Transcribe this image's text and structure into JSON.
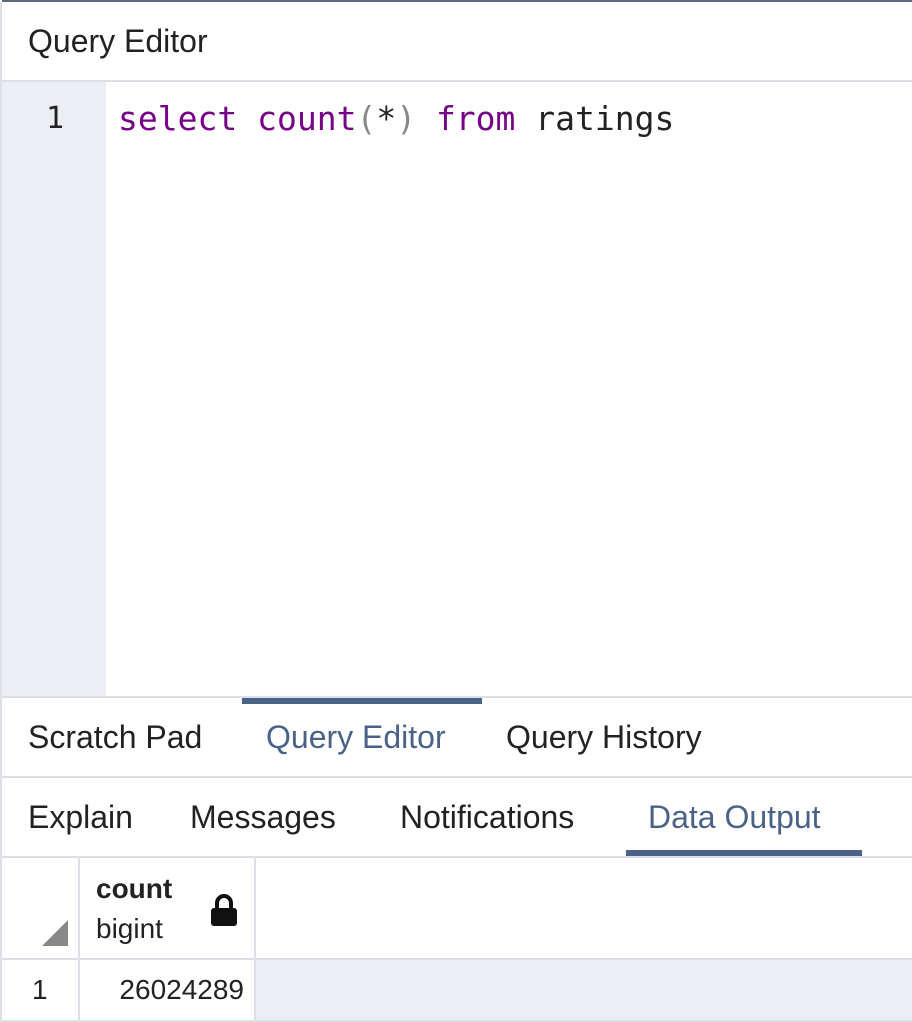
{
  "panel": {
    "title": "Query Editor"
  },
  "editor": {
    "line_number": "1",
    "tokens": {
      "select": "select",
      "count": "count",
      "open_paren": "(",
      "star": "*",
      "close_paren": ")",
      "from": "from",
      "table": "ratings"
    }
  },
  "panel_tabs": [
    {
      "label": "Scratch Pad",
      "active": false
    },
    {
      "label": "Query Editor",
      "active": true
    },
    {
      "label": "Query History",
      "active": false
    }
  ],
  "output_tabs": [
    {
      "label": "Explain",
      "active": false
    },
    {
      "label": "Messages",
      "active": false
    },
    {
      "label": "Notifications",
      "active": false
    },
    {
      "label": "Data Output",
      "active": true
    }
  ],
  "grid": {
    "columns": [
      {
        "name": "count",
        "type": "bigint",
        "icon": "lock-icon"
      }
    ],
    "rows": [
      {
        "row_number": "1",
        "values": [
          "26024289"
        ]
      }
    ]
  },
  "colors": {
    "keyword": "#770088",
    "active_tab": "#4a6288",
    "gutter": "#eceef3",
    "border": "#dde0e6"
  }
}
